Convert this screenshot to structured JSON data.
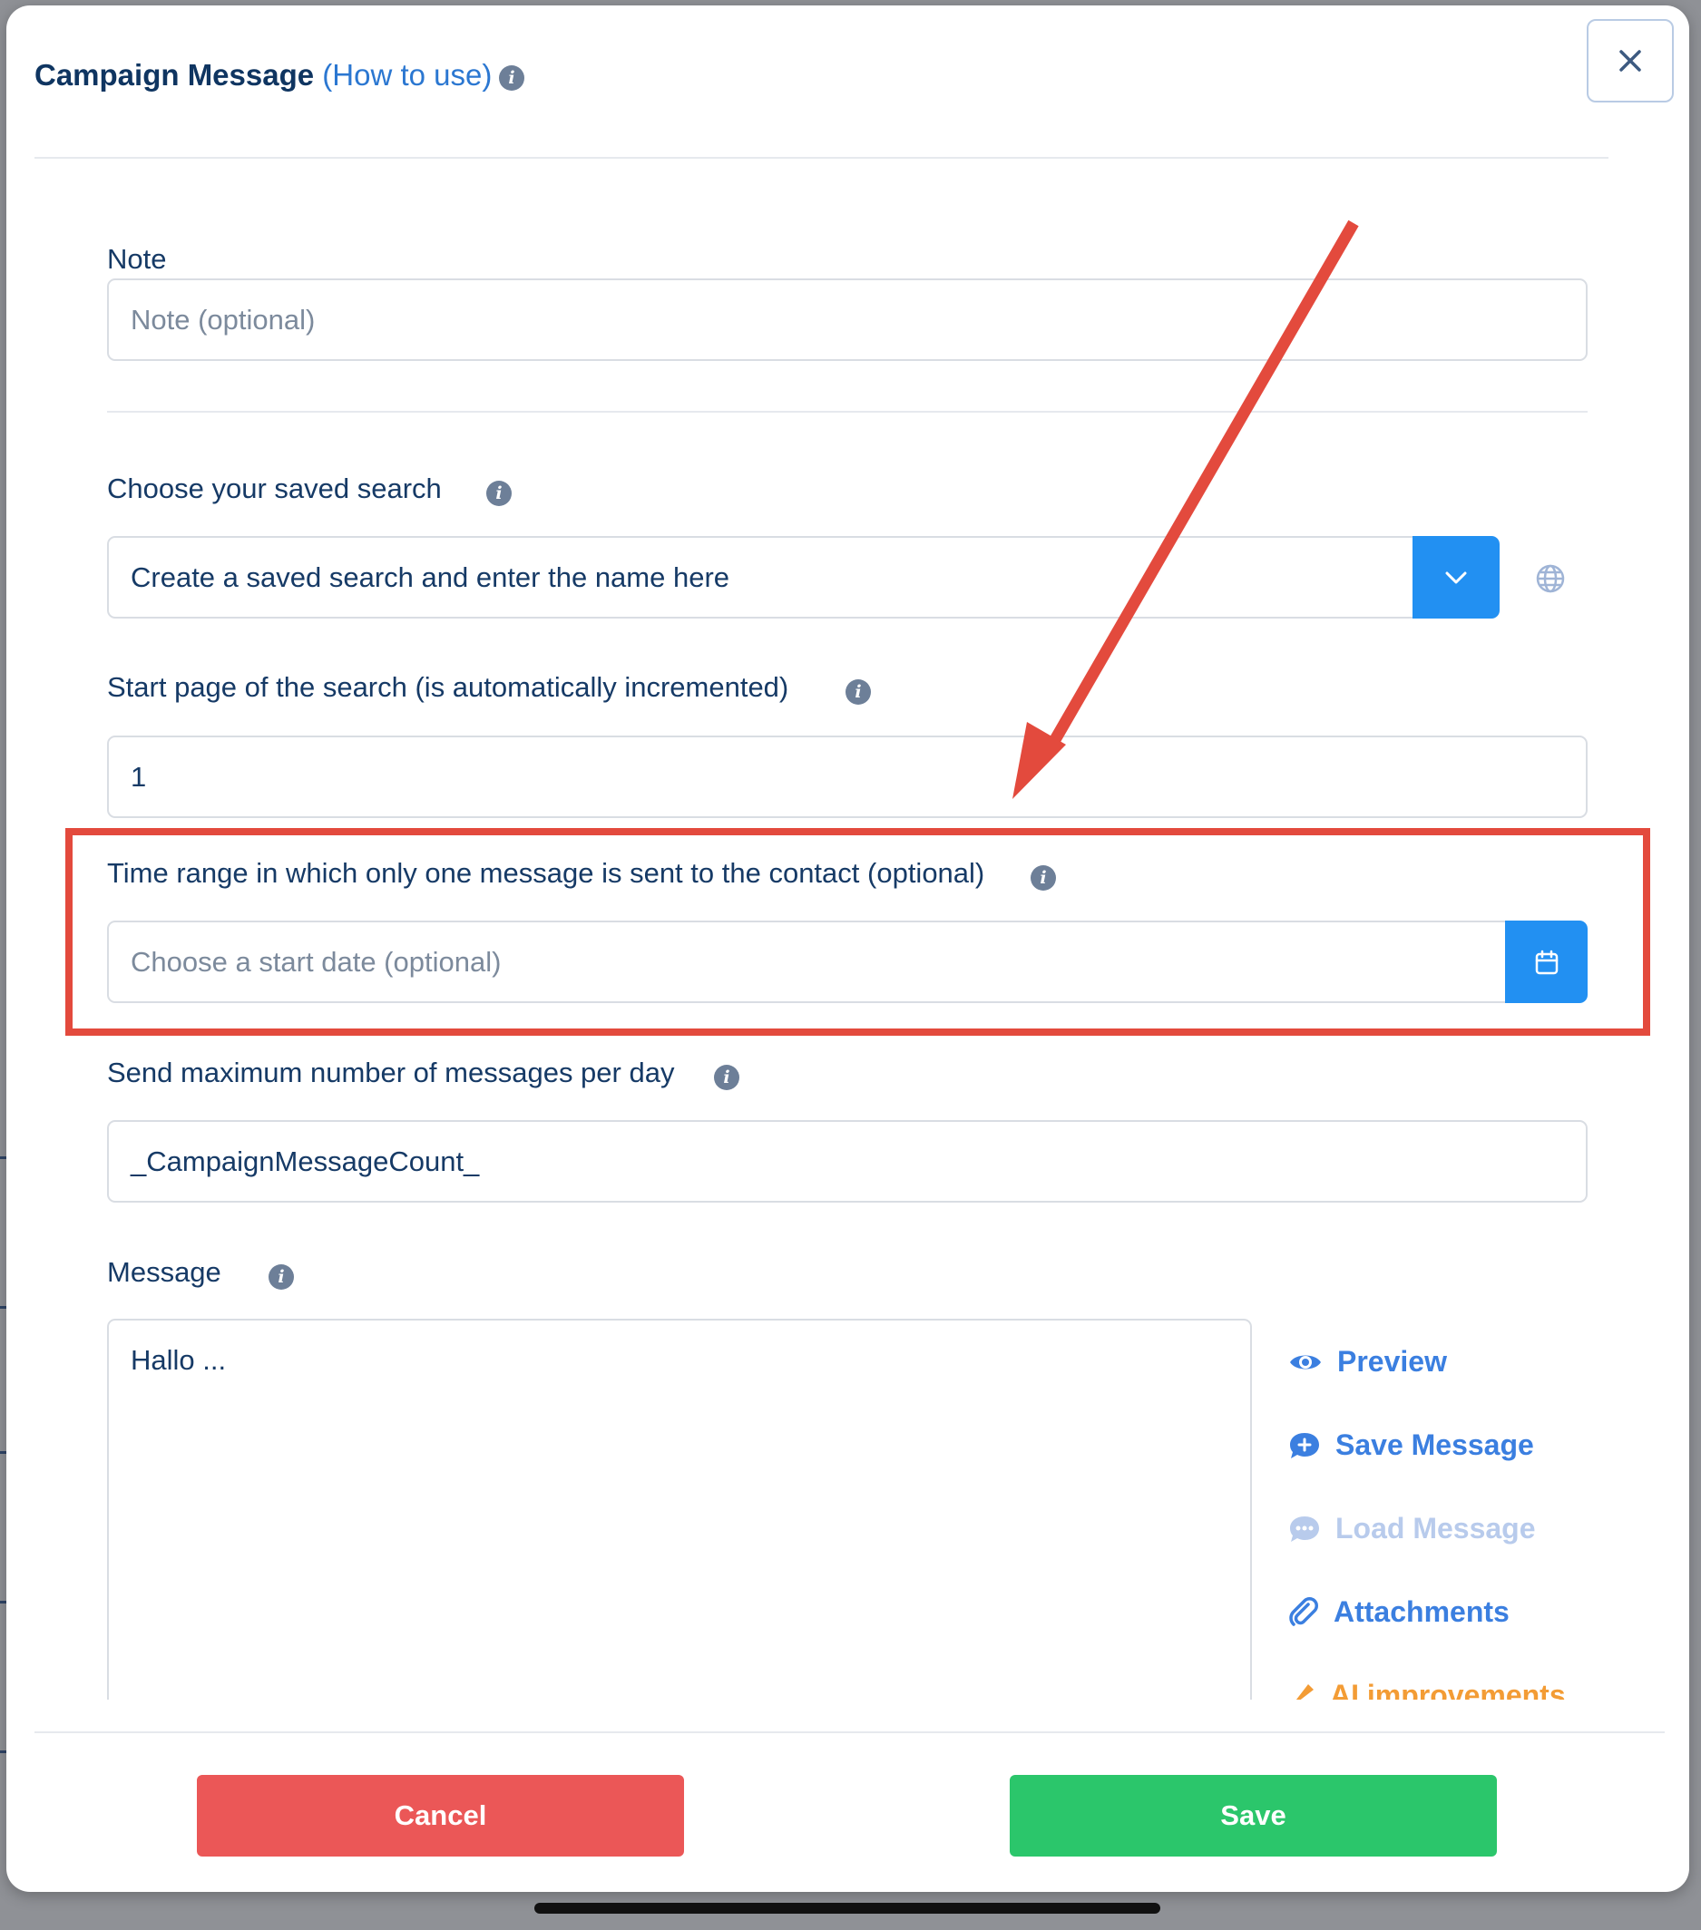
{
  "header": {
    "title": "Campaign Message",
    "how_to_use": "(How to use)"
  },
  "form": {
    "note": {
      "label": "Note",
      "placeholder": "Note (optional)"
    },
    "saved_search": {
      "label": "Choose your saved search",
      "value": "Create a saved search and enter the name here"
    },
    "start_page": {
      "label": "Start page of the search (is automatically incremented)",
      "value": "1"
    },
    "time_range": {
      "label": "Time range in which only one message is sent to the contact (optional)",
      "placeholder": "Choose a start date (optional)"
    },
    "max_messages": {
      "label": "Send maximum number of messages per day",
      "value": "_CampaignMessageCount_"
    },
    "message": {
      "label": "Message",
      "value": "Hallo ..."
    }
  },
  "message_actions": {
    "preview": "Preview",
    "save_message": "Save Message",
    "load_message": "Load Message",
    "attachments": "Attachments",
    "ai_improvements": "AI improvements"
  },
  "footer": {
    "cancel": "Cancel",
    "save": "Save"
  },
  "colors": {
    "primary_blue": "#2290f2",
    "cancel_red": "#eb5757",
    "save_green": "#2bc66b",
    "annotation_red": "#e34a3d",
    "link_blue": "#3b7fe0",
    "ai_orange": "#f39c35"
  }
}
